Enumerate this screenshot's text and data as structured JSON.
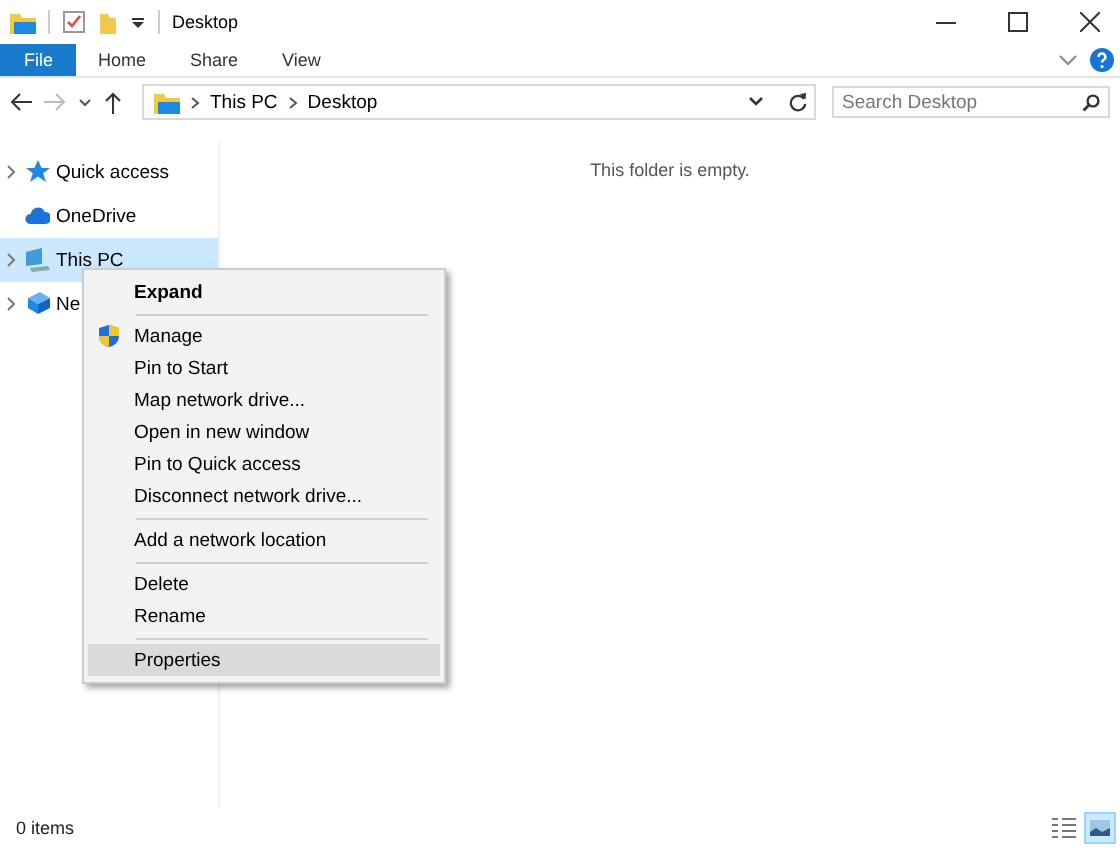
{
  "window": {
    "title": "Desktop"
  },
  "ribbon": {
    "tabs": [
      {
        "label": "File",
        "kind": "file",
        "selected": false
      },
      {
        "label": "Home",
        "kind": "tab",
        "selected": false
      },
      {
        "label": "Share",
        "kind": "tab",
        "selected": false
      },
      {
        "label": "View",
        "kind": "tab",
        "selected": false
      }
    ]
  },
  "address_bar": {
    "path": [
      "This PC",
      "Desktop"
    ],
    "search": {
      "placeholder": "Search Desktop"
    }
  },
  "navigation": {
    "items": [
      {
        "label": "Quick access",
        "kind": "star",
        "expandable": true,
        "selected": false
      },
      {
        "label": "OneDrive",
        "kind": "cloud",
        "expandable": false,
        "selected": false
      },
      {
        "label": "This PC",
        "kind": "pc",
        "expandable": true,
        "selected": true
      },
      {
        "label": "Ne",
        "kind": "network",
        "expandable": true,
        "selected": false
      }
    ]
  },
  "content": {
    "message": "This folder is empty."
  },
  "context_menu": {
    "items": [
      {
        "kind": "item",
        "label": "Expand",
        "default": true,
        "shield": false,
        "selected": false
      },
      {
        "kind": "separator"
      },
      {
        "kind": "item",
        "label": "Manage",
        "default": false,
        "shield": true,
        "selected": false
      },
      {
        "kind": "item",
        "label": "Pin to Start",
        "default": false,
        "shield": false,
        "selected": false
      },
      {
        "kind": "item",
        "label": "Map network drive...",
        "default": false,
        "shield": false,
        "selected": false
      },
      {
        "kind": "item",
        "label": "Open in new window",
        "default": false,
        "shield": false,
        "selected": false
      },
      {
        "kind": "item",
        "label": "Pin to Quick access",
        "default": false,
        "shield": false,
        "selected": false
      },
      {
        "kind": "item",
        "label": "Disconnect network drive...",
        "default": false,
        "shield": false,
        "selected": false
      },
      {
        "kind": "separator"
      },
      {
        "kind": "item",
        "label": "Add a network location",
        "default": false,
        "shield": false,
        "selected": false
      },
      {
        "kind": "separator"
      },
      {
        "kind": "item",
        "label": "Delete",
        "default": false,
        "shield": false,
        "selected": false
      },
      {
        "kind": "item",
        "label": "Rename",
        "default": false,
        "shield": false,
        "selected": false
      },
      {
        "kind": "separator"
      },
      {
        "kind": "item",
        "label": "Properties",
        "default": false,
        "shield": false,
        "selected": true
      }
    ]
  },
  "status_bar": {
    "text": "0 items",
    "views": [
      {
        "kind": "details",
        "selected": false
      },
      {
        "kind": "large-icons",
        "selected": true
      }
    ]
  }
}
